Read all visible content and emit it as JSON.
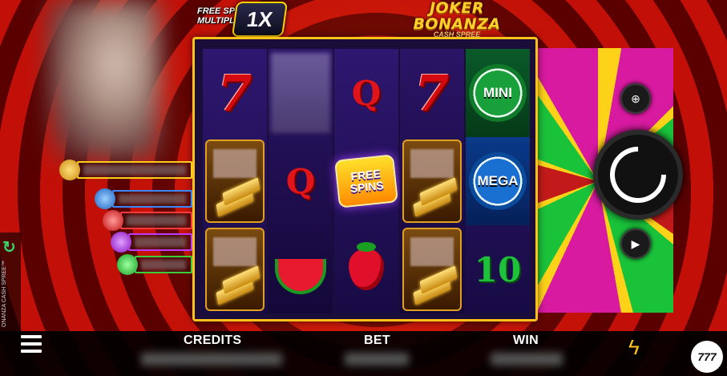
{
  "game": {
    "logo_line1": "JOKER",
    "logo_line2": "BONANZA",
    "logo_sub": "CASH SPREE",
    "side_title": "ONANZA CASH SPREE™"
  },
  "multiplier": {
    "label": "FREE SPIN MULTIPLIER",
    "value": "1X"
  },
  "reels": {
    "free_spins_line1": "FREE",
    "free_spins_line2": "SPINS",
    "mini_label": "MINI",
    "mega_label": "MEGA",
    "q1": "Q",
    "q2": "Q",
    "ten": "10",
    "seven1": "7",
    "seven2": "7"
  },
  "bottom": {
    "credits_label": "CREDITS",
    "bet_label": "BET",
    "win_label": "WIN",
    "badge": "777"
  },
  "colors": {
    "accent_gold": "#ffc21a",
    "mini_green": "#1aa03a",
    "mega_blue": "#1a70d0"
  }
}
